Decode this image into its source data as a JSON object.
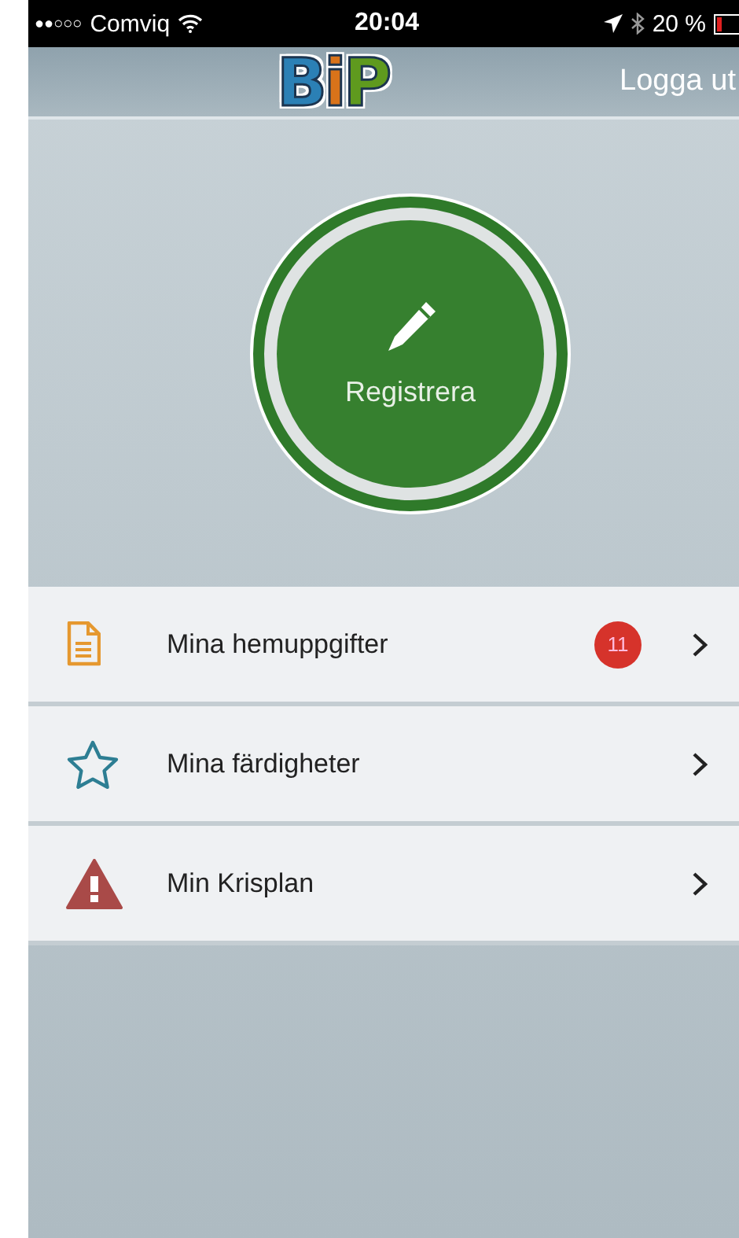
{
  "status_bar": {
    "signal": "●●○○○",
    "carrier": "Comviq",
    "time": "20:04",
    "battery": "20 %"
  },
  "nav_bar": {
    "logo": "BiP",
    "logout": "Logga ut"
  },
  "register_button": {
    "label": "Registrera"
  },
  "menu": [
    {
      "kind": "document",
      "label": "Mina hemuppgifter",
      "badge": "11"
    },
    {
      "kind": "star",
      "label": "Mina färdigheter"
    },
    {
      "kind": "warning",
      "label": "Min Krisplan"
    }
  ]
}
